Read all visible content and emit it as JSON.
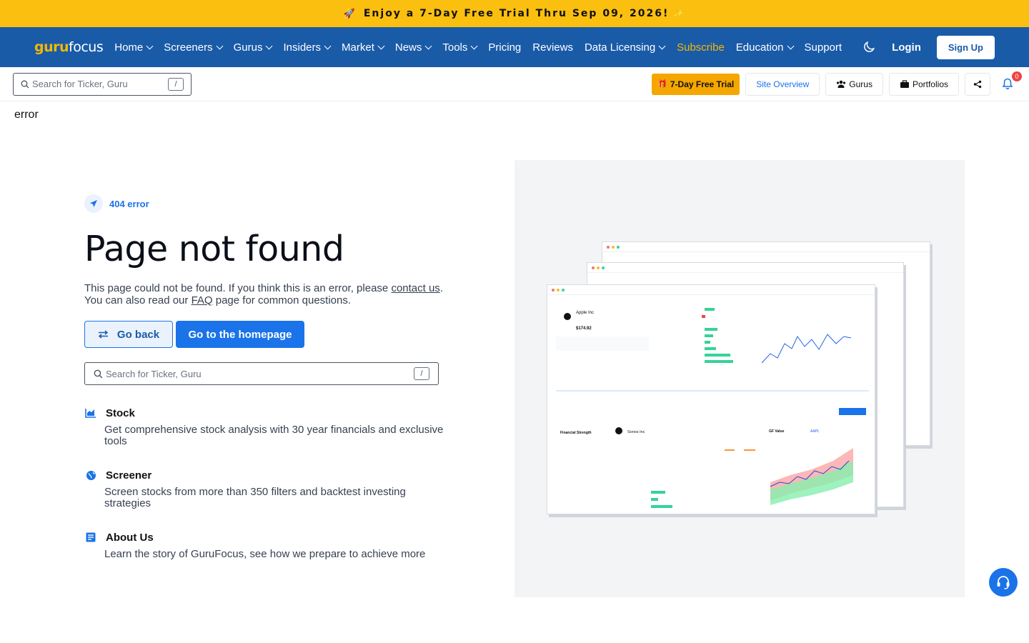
{
  "promo": {
    "text": "Enjoy a 7-Day Free Trial Thru Sep 09, 2026!"
  },
  "nav": {
    "logo_a": "guru",
    "logo_b": "focus",
    "items": [
      {
        "label": "Home",
        "dropdown": true
      },
      {
        "label": "Screeners",
        "dropdown": true
      },
      {
        "label": "Gurus",
        "dropdown": true
      },
      {
        "label": "Insiders",
        "dropdown": true
      },
      {
        "label": "Market",
        "dropdown": true
      },
      {
        "label": "News",
        "dropdown": true
      },
      {
        "label": "Tools",
        "dropdown": true
      },
      {
        "label": "Pricing",
        "dropdown": false
      },
      {
        "label": "Reviews",
        "dropdown": false
      },
      {
        "label": "Data Licensing",
        "dropdown": true
      }
    ],
    "subscribe": "Subscribe",
    "education": "Education",
    "support": "Support",
    "login": "Login",
    "signup": "Sign Up"
  },
  "toolbar": {
    "search_placeholder": "Search for Ticker, Guru",
    "slash": "/",
    "trial": "7-Day Free Trial",
    "site_overview": "Site Overview",
    "gurus": "Gurus",
    "portfolios": "Portfolios",
    "notification_count": "0"
  },
  "page": {
    "error_word": "error",
    "eyebrow": "404 error",
    "title": "Page not found",
    "desc_1": "This page could not be found. If you think this is an error, please ",
    "contact_link": "contact us",
    "desc_1_end": ".",
    "desc_2_start": "You can also read our ",
    "faq_link": "FAQ",
    "desc_2_end": " page for common questions.",
    "go_back": "Go back",
    "go_home": "Go to the homepage",
    "search_placeholder": "Search for Ticker, Guru",
    "slash": "/"
  },
  "features": [
    {
      "title": "Stock",
      "text": "Get comprehensive stock analysis with 30 year financials and exclusive tools",
      "icon": "chart-icon"
    },
    {
      "title": "Screener",
      "text": "Screen stocks from more than 350 filters and backtest investing strategies",
      "icon": "globe-icon"
    },
    {
      "title": "About Us",
      "text": "Learn the story of GuruFocus, see how we prepare to achieve more",
      "icon": "document-icon"
    }
  ],
  "illustration": {
    "company_1": "Apple Inc",
    "price_1": "$174.92",
    "company_2": "Sonos Inc",
    "section_1": "Financial Strength",
    "section_2": "GF Value",
    "ticker": "AAPL"
  },
  "colors": {
    "promo": "#fbbf0f",
    "nav": "#1a5ba8",
    "accent": "#1a73e8",
    "brand_gold": "#f5b800"
  }
}
